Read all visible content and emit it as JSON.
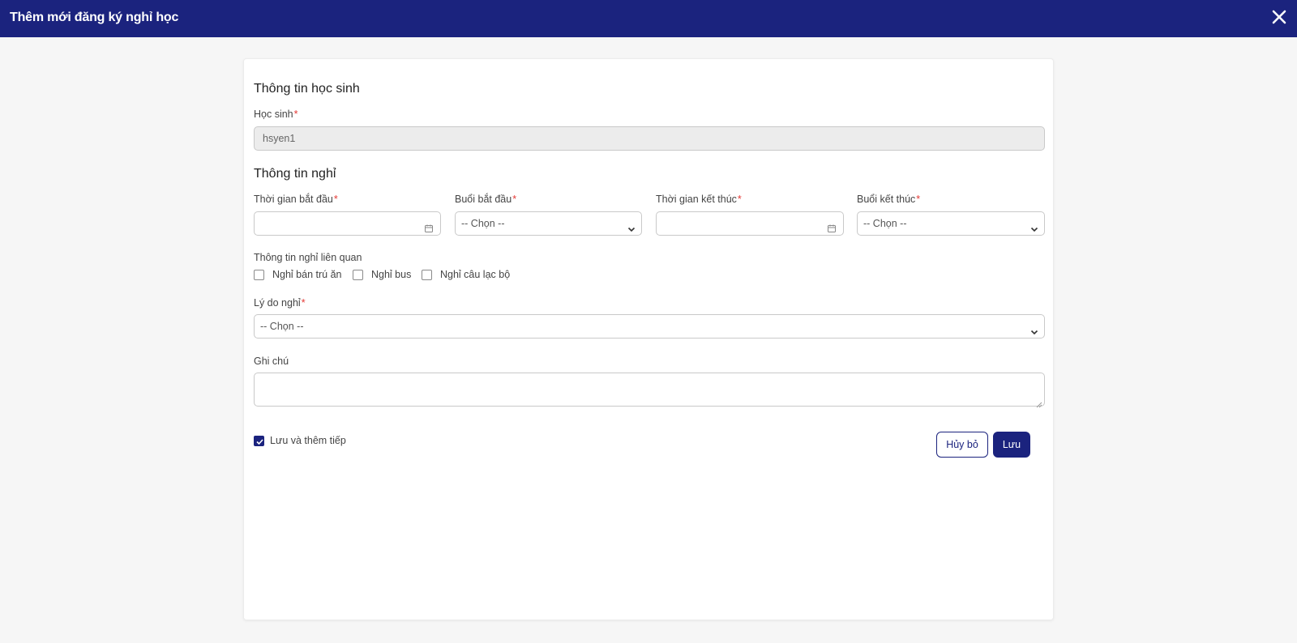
{
  "header": {
    "title": "Thêm mới đăng ký nghỉ học",
    "close_icon": "close-icon"
  },
  "student_section": {
    "title": "Thông tin học sinh",
    "student_label": "Học sinh",
    "student_value": "hsyen1"
  },
  "leave_section": {
    "title": "Thông tin nghỉ",
    "start_time_label": "Thời gian bắt đầu",
    "start_session_label": "Buổi bắt đầu",
    "start_session_value": "-- Chọn --",
    "end_time_label": "Thời gian kết thúc",
    "end_session_label": "Buổi kết thúc",
    "end_session_value": "-- Chọn --",
    "related_label": "Thông tin nghỉ liên quan",
    "related_options": [
      "Nghỉ bán trú ăn",
      "Nghỉ bus",
      "Nghỉ câu lạc bộ"
    ],
    "reason_label": "Lý do nghỉ",
    "reason_value": "-- Chọn --",
    "note_label": "Ghi chú",
    "note_value": ""
  },
  "footer": {
    "save_and_continue_label": "Lưu và thêm tiếp",
    "save_and_continue_checked": true,
    "cancel_label": "Hủy bỏ",
    "save_label": "Lưu"
  },
  "required_mark": "*",
  "colors": {
    "primary": "#1b237e",
    "required": "#e53935",
    "background": "#f6f6f6"
  }
}
